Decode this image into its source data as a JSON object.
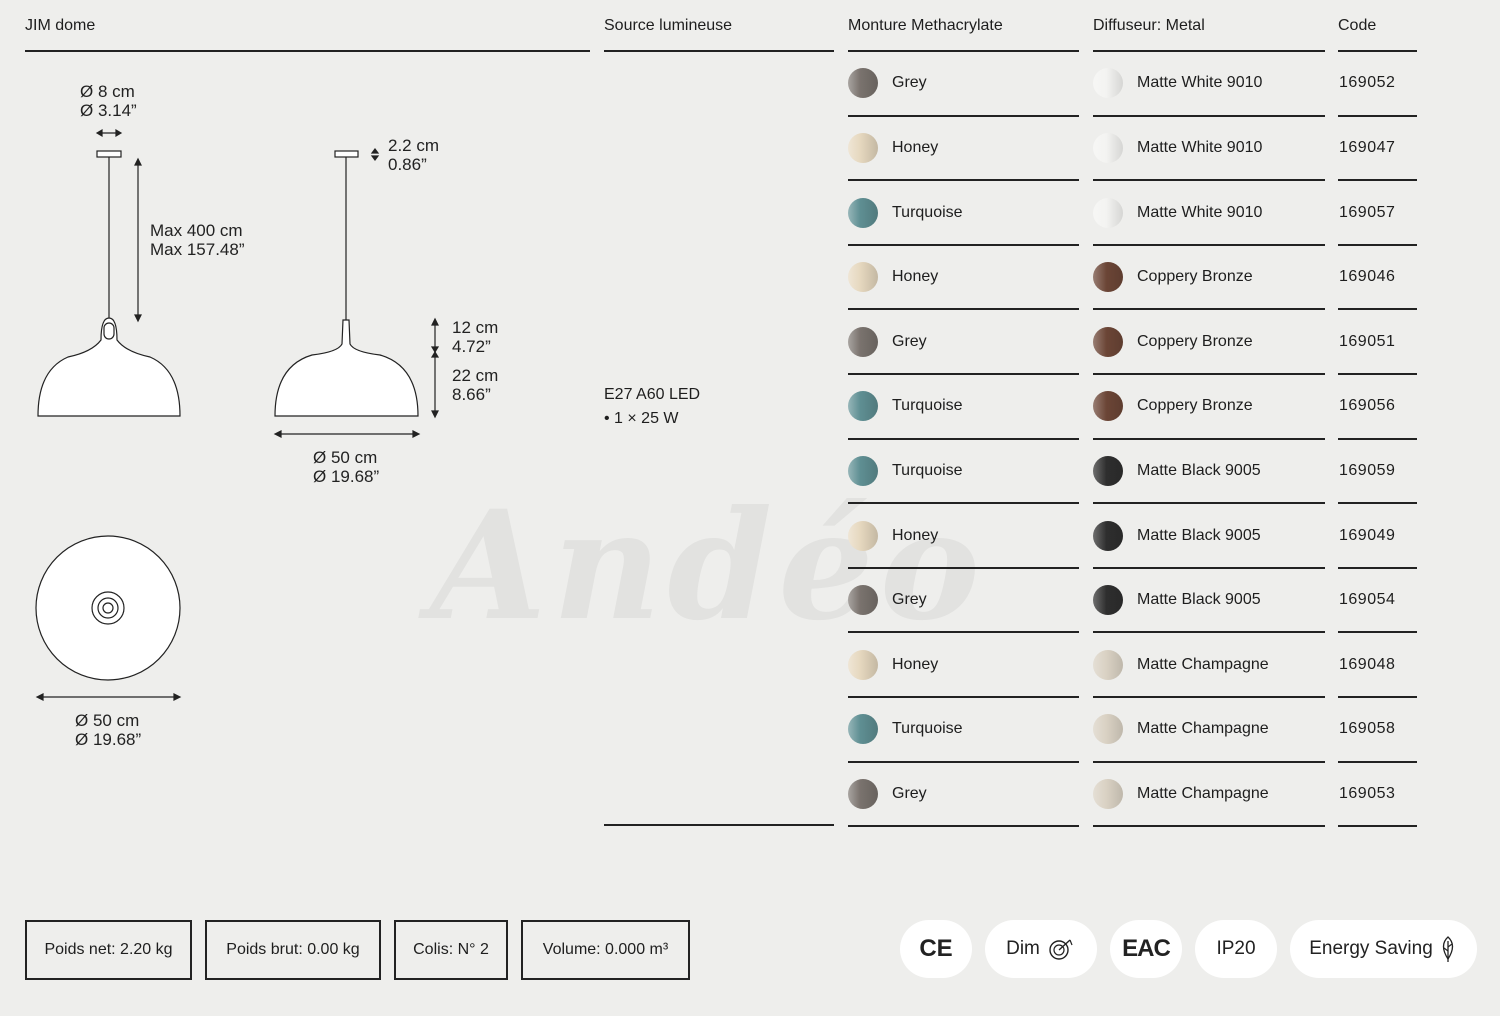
{
  "headers": {
    "product": "JIM dome",
    "source": "Source lumineuse",
    "monture": "Monture Methacrylate",
    "diffuseur": "Diffuseur: Metal",
    "code": "Code"
  },
  "dimensions": {
    "canopy_cm": "Ø 8 cm",
    "canopy_in": "Ø 3.14”",
    "cable_cm": "Max 400 cm",
    "cable_in": "Max 157.48”",
    "canopy_h_cm": "2.2 cm",
    "canopy_h_in": "0.86”",
    "neck_cm": "12 cm",
    "neck_in": "4.72”",
    "shade_cm": "22 cm",
    "shade_in": "8.66”",
    "width_cm": "Ø 50 cm",
    "width_in": "Ø 19.68”",
    "top_width_cm": "Ø 50 cm",
    "top_width_in": "Ø 19.68”"
  },
  "light_source": {
    "type": "E27 A60 LED",
    "power": "• 1 × 25 W"
  },
  "rows": [
    {
      "monture": "Grey",
      "monture_color": "#7a736e",
      "diffuseur": "Matte White 9010",
      "diffuseur_color": "#f3f3f1",
      "code": "169052"
    },
    {
      "monture": "Honey",
      "monture_color": "#e6d8bf",
      "diffuseur": "Matte White 9010",
      "diffuseur_color": "#f3f3f1",
      "code": "169047"
    },
    {
      "monture": "Turquoise",
      "monture_color": "#5f8f93",
      "diffuseur": "Matte White 9010",
      "diffuseur_color": "#f3f3f1",
      "code": "169057"
    },
    {
      "monture": "Honey",
      "monture_color": "#e6d8bf",
      "diffuseur": "Coppery Bronze",
      "diffuseur_color": "#6b4536",
      "code": "169046"
    },
    {
      "monture": "Grey",
      "monture_color": "#7a736e",
      "diffuseur": "Coppery Bronze",
      "diffuseur_color": "#6b4536",
      "code": "169051"
    },
    {
      "monture": "Turquoise",
      "monture_color": "#5f8f93",
      "diffuseur": "Coppery Bronze",
      "diffuseur_color": "#6b4536",
      "code": "169056"
    },
    {
      "monture": "Turquoise",
      "monture_color": "#5f8f93",
      "diffuseur": "Matte Black 9005",
      "diffuseur_color": "#2e2e2e",
      "code": "169059"
    },
    {
      "monture": "Honey",
      "monture_color": "#e6d8bf",
      "diffuseur": "Matte Black 9005",
      "diffuseur_color": "#2e2e2e",
      "code": "169049"
    },
    {
      "monture": "Grey",
      "monture_color": "#7a736e",
      "diffuseur": "Matte Black 9005",
      "diffuseur_color": "#2e2e2e",
      "code": "169054"
    },
    {
      "monture": "Honey",
      "monture_color": "#e6d8bf",
      "diffuseur": "Matte Champagne",
      "diffuseur_color": "#d9d1c3",
      "code": "169048"
    },
    {
      "monture": "Turquoise",
      "monture_color": "#5f8f93",
      "diffuseur": "Matte Champagne",
      "diffuseur_color": "#d9d1c3",
      "code": "169058"
    },
    {
      "monture": "Grey",
      "monture_color": "#7a736e",
      "diffuseur": "Matte Champagne",
      "diffuseur_color": "#d9d1c3",
      "code": "169053"
    }
  ],
  "footer": {
    "poids_net": "Poids net: 2.20 kg",
    "poids_brut": "Poids brut: 0.00 kg",
    "colis": "Colis: N° 2",
    "volume": "Volume: 0.000 m³"
  },
  "badges": {
    "ce": "CE",
    "dim": "Dim",
    "eac": "EAC",
    "ip": "IP20",
    "energy": "Energy Saving"
  },
  "watermark": "Andéo"
}
